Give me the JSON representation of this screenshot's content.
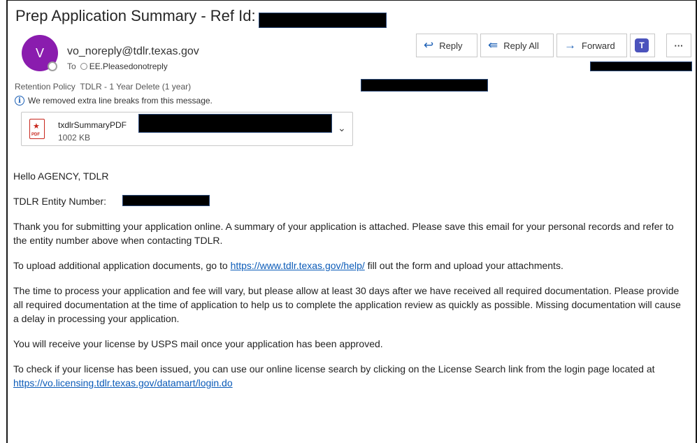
{
  "email": {
    "subject": "Prep Application Summary - Ref Id:",
    "avatar_initial": "V",
    "sender": "vo_noreply@tdlr.texas.gov",
    "to_label": "To",
    "to_recipient": "EE.Pleasedonotreply",
    "retention_label": "Retention Policy",
    "retention_value": "TDLR - 1 Year Delete (1 year)",
    "info_notice": "We removed extra line breaks from this message."
  },
  "attachment": {
    "name": "txdlrSummaryPDF",
    "size": "1002 KB",
    "type_tag": "PDF"
  },
  "toolbar": {
    "reply": "Reply",
    "reply_all": "Reply All",
    "forward": "Forward",
    "more": "···"
  },
  "body": {
    "greeting": "Hello AGENCY, TDLR",
    "entity_label": "TDLR Entity Number:",
    "para1": "Thank you for submitting your application online.  A summary of your application is attached. Please save this email for your personal records and refer to the entity number above when contacting TDLR.",
    "para2_pre": "To upload additional application documents, go to ",
    "para2_link": "https://www.tdlr.texas.gov/help/",
    "para2_post": " fill out the form and upload your attachments.",
    "para3": "The time to process your application and fee will vary, but please allow at least 30 days after we have received all required documentation. Please provide all required documentation at the time of application to help us to complete the application review as quickly as possible. Missing documentation will cause a delay in processing your application.",
    "para4": "You will receive your license by USPS mail once your application has been approved.",
    "para5_pre": "To check if your license has been issued, you can use our online license search by clicking on the License Search link from the login page located at ",
    "para5_link": "https://vo.licensing.tdlr.texas.gov/datamart/login.do"
  },
  "colors": {
    "avatar": "#8a1cae",
    "link": "#0b5bb8",
    "accent": "#1b5fb5",
    "redaction": "#000000"
  }
}
